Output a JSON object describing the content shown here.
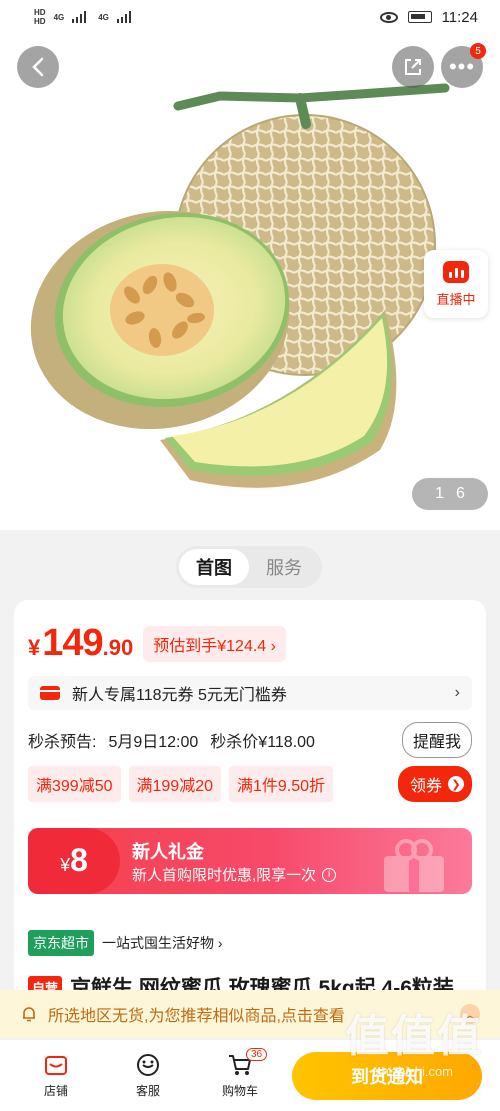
{
  "status_bar": {
    "net1": "4G",
    "net2": "4G",
    "hd": "HD",
    "time": "11:24"
  },
  "hero": {
    "more_badge": "5",
    "live_label": "直播中",
    "pager_current": "1",
    "pager_total": "6"
  },
  "tabs": [
    {
      "label": "首图",
      "active": true
    },
    {
      "label": "服务",
      "active": false
    }
  ],
  "price": {
    "currency": "¥",
    "integer": "149",
    "decimal": ".90",
    "estimate": "预估到手¥124.4"
  },
  "coupon_bar": {
    "text": "新人专属118元券 5元无门槛券",
    "chevron": "›"
  },
  "seckill": {
    "label": "秒杀预告:",
    "time": "5月9日12:00",
    "price_text": "秒杀价¥118.00",
    "remind_label": "提醒我"
  },
  "chips": [
    "满399减50",
    "满199减20",
    "满1件9.50折"
  ],
  "get_coupon_label": "领券",
  "gift": {
    "currency": "¥",
    "amount": "8",
    "title": "新人礼金",
    "desc": "新人首购限时优惠,限享一次"
  },
  "store": {
    "tag": "京东超市",
    "slogan": "一站式囤生活好物 ›"
  },
  "title": {
    "tag": "自营",
    "text": "京鲜生 网纹蜜瓜 玫瑰蜜瓜 5kg起 4-6粒装"
  },
  "notice": {
    "text": "所选地区无货,为您推荐相似商品,点击查看"
  },
  "bottom_nav": [
    {
      "label": "店铺",
      "icon": "store-icon"
    },
    {
      "label": "客服",
      "icon": "service-icon"
    },
    {
      "label": "购物车",
      "icon": "cart-icon",
      "badge": "36"
    }
  ],
  "buy_label": "到货通知",
  "watermark": {
    "logo": "值值值",
    "site": "zhizhizhi.com"
  },
  "colors": {
    "accent": "#f2270c",
    "green": "#1e9f5c",
    "notice_bg": "#fdf6d9",
    "buy": "#ffb300"
  }
}
